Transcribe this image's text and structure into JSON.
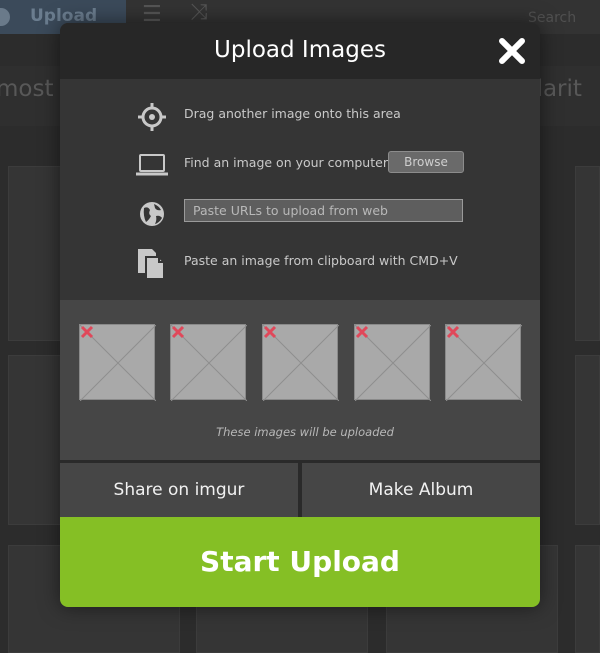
{
  "background": {
    "upload_label": "Upload",
    "search_label": "Search",
    "sort_left": "most",
    "sort_right": "ularit"
  },
  "modal": {
    "title": "Upload Images",
    "close_icon": "close-icon",
    "options": {
      "drag_text": "Drag another image onto this area",
      "find_text": "Find an image on your computer",
      "browse_label": "Browse",
      "url_placeholder": "Paste URLs to upload from web",
      "url_value": "",
      "clipboard_text": "Paste an image from clipboard with CMD+V"
    },
    "thumbnails_count": 5,
    "thumbs_caption": "These images will be uploaded",
    "share_label": "Share on imgur",
    "album_label": "Make Album",
    "start_label": "Start Upload"
  },
  "colors": {
    "accent_green": "#85bf25",
    "remove_red": "#e0485a",
    "header_bg": "#272727",
    "thumb_area_bg": "#464646"
  }
}
